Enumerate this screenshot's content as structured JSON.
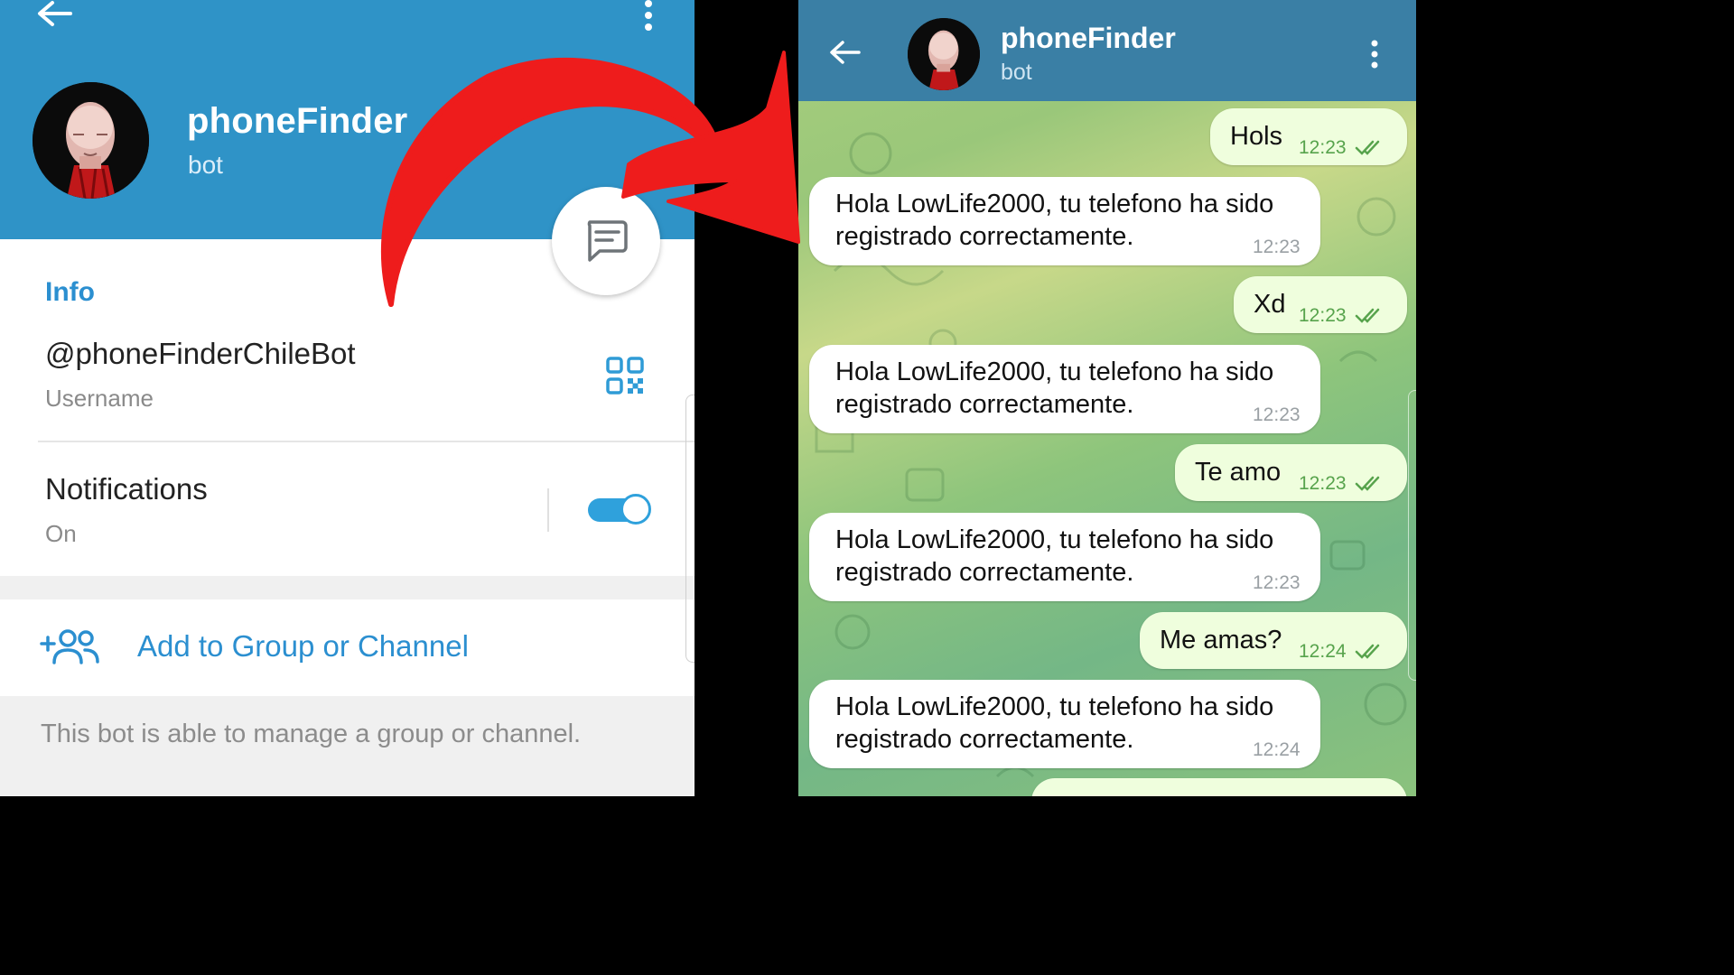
{
  "profile": {
    "title": "phoneFinder",
    "subtitle": "bot",
    "info_label": "Info",
    "username": "@phoneFinderChileBot",
    "username_caption": "Username",
    "notifications_label": "Notifications",
    "notifications_state": "On",
    "add_label": "Add to Group or Channel",
    "footer_note": "This bot is able to manage a group or channel.",
    "accent_color": "#2f93c7",
    "link_color": "#2b8fd0",
    "notifications_on": true,
    "icons": [
      "back-arrow-icon",
      "more-vert-icon",
      "message-icon",
      "qr-code-icon",
      "add-group-icon"
    ]
  },
  "chat": {
    "title": "phoneFinder",
    "subtitle": "bot",
    "header_color": "#3a7fa5",
    "outgoing_color": "#effedd",
    "messages": [
      {
        "dir": "out",
        "text": "Hols",
        "time": "12:23",
        "read": true
      },
      {
        "dir": "in",
        "line1": "Hola LowLife2000, tu telefono ha sido",
        "line2": "registrado correctamente.",
        "time": "12:23"
      },
      {
        "dir": "out",
        "text": "Xd",
        "time": "12:23",
        "read": true
      },
      {
        "dir": "in",
        "line1": "Hola LowLife2000, tu telefono ha sido",
        "line2": "registrado correctamente.",
        "time": "12:23"
      },
      {
        "dir": "out",
        "text": "Te amo",
        "time": "12:23",
        "read": true
      },
      {
        "dir": "in",
        "line1": "Hola LowLife2000, tu telefono ha sido",
        "line2": "registrado correctamente.",
        "time": "12:23"
      },
      {
        "dir": "out",
        "text": "Me amas?",
        "time": "12:24",
        "read": true
      },
      {
        "dir": "in",
        "line1": "Hola LowLife2000, tu telefono ha sido",
        "line2": "registrado correctamente.",
        "time": "12:24"
      }
    ]
  },
  "overlay": {
    "arrow_color": "#ee1c1c"
  }
}
